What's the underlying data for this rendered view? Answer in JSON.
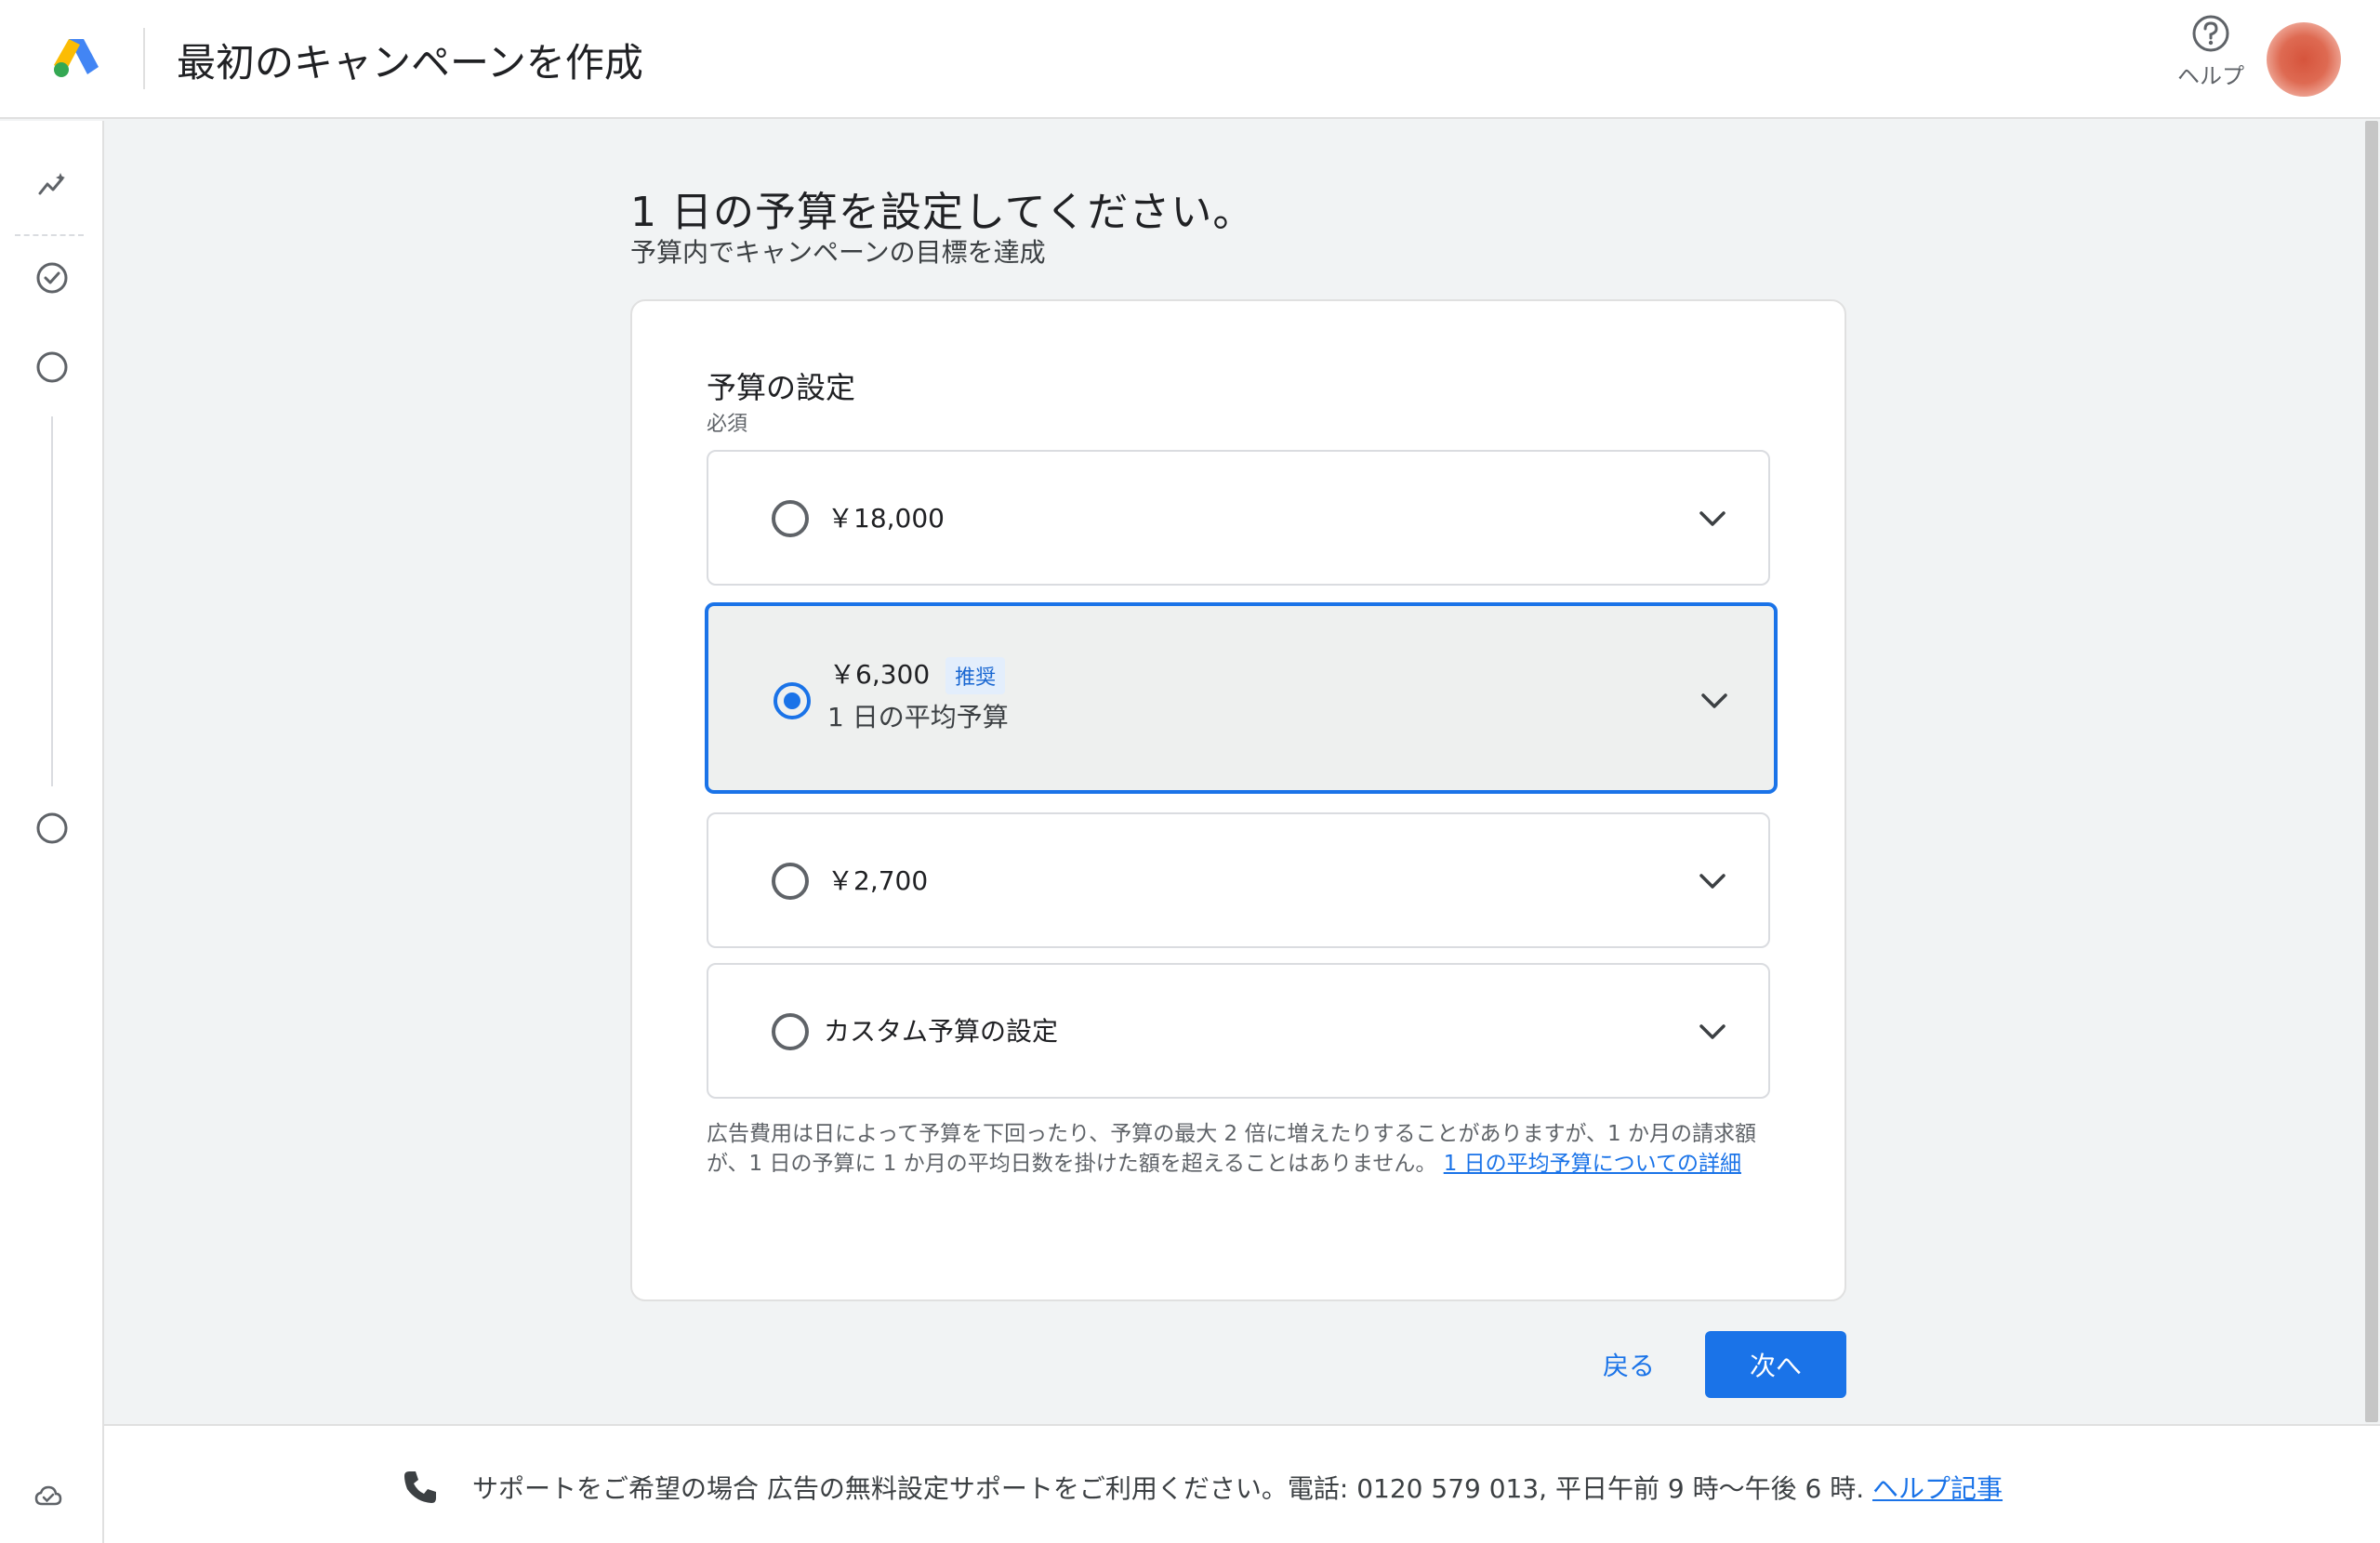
{
  "header": {
    "title": "最初のキャンペーンを作成",
    "help_label": "ヘルプ"
  },
  "colors": {
    "accent": "#1a73e8",
    "background": "#f1f3f4",
    "card": "#ffffff"
  },
  "sidebar": {
    "icons": [
      "sparkle-icon",
      "check-circle-icon",
      "empty-circle-icon",
      "empty-circle-icon",
      "cloud-sync-icon"
    ]
  },
  "main": {
    "title": "1 日の予算を設定してください。",
    "subtitle": "予算内でキャンペーンの目標を達成",
    "section_title": "予算の設定",
    "required_label": "必須",
    "options": [
      {
        "label": "￥18,000",
        "selected": false
      },
      {
        "label": "￥6,300",
        "badge": "推奨",
        "sublabel": "1 日の平均予算",
        "selected": true
      },
      {
        "label": "￥2,700",
        "selected": false
      },
      {
        "label": "カスタム予算の設定",
        "selected": false
      }
    ],
    "note_text": "広告費用は日によって予算を下回ったり、予算の最大 2 倍に増えたりすることがありますが、1 か月の請求額が、1 日の予算に 1 か月の平均日数を掛けた額を超えることはありません。",
    "note_link": "1 日の平均予算についての詳細"
  },
  "actions": {
    "back_label": "戻る",
    "next_label": "次へ"
  },
  "footer": {
    "text": "サポートをご希望の場合 広告の無料設定サポートをご利用ください。電話: 0120 579 013, 平日午前 9 時～午後 6 時.",
    "link": "ヘルプ記事"
  }
}
